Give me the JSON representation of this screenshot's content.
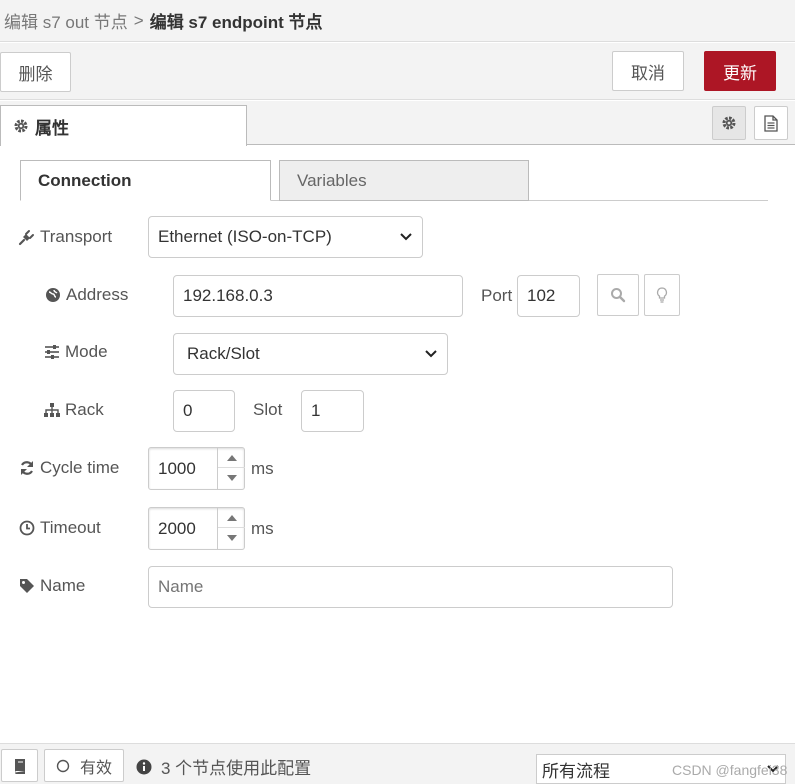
{
  "breadcrumb": {
    "parent": "编辑 s7 out 节点",
    "separator": ">",
    "current": "编辑 s7 endpoint 节点"
  },
  "toolbar": {
    "delete_label": "删除",
    "cancel_label": "取消",
    "update_label": "更新"
  },
  "panel_tab": {
    "label": "属性"
  },
  "sub_tabs": {
    "connection": "Connection",
    "variables": "Variables"
  },
  "form": {
    "transport": {
      "label": "Transport",
      "value": "Ethernet (ISO-on-TCP)"
    },
    "address": {
      "label": "Address",
      "value": "192.168.0.3"
    },
    "port": {
      "label": "Port",
      "value": "102"
    },
    "mode": {
      "label": "Mode",
      "value": "Rack/Slot"
    },
    "rack": {
      "label": "Rack",
      "value": "0"
    },
    "slot": {
      "label": "Slot",
      "value": "1"
    },
    "cycle_time": {
      "label": "Cycle time",
      "value": "1000",
      "unit": "ms"
    },
    "timeout": {
      "label": "Timeout",
      "value": "2000",
      "unit": "ms"
    },
    "name": {
      "label": "Name",
      "placeholder": "Name"
    }
  },
  "footer": {
    "valid_label": "有效",
    "usage_text": "3 个节点使用此配置",
    "scope_value": "所有流程",
    "watermark": "CSDN @fangfei38"
  },
  "colors": {
    "primary": "#ad1625",
    "header_bg": "#f3f3f3"
  },
  "icons": {
    "panel_tab": "gear-icon",
    "settings": "gear-icon",
    "description": "document-icon",
    "transport": "plug-icon",
    "address": "globe-icon",
    "mode": "sliders-icon",
    "rack": "sitemap-icon",
    "cycle_time": "refresh-icon",
    "timeout": "clock-icon",
    "name": "tag-icon",
    "search": "search-icon",
    "hint": "lightbulb-icon",
    "info": "info-icon",
    "book": "book-icon"
  }
}
